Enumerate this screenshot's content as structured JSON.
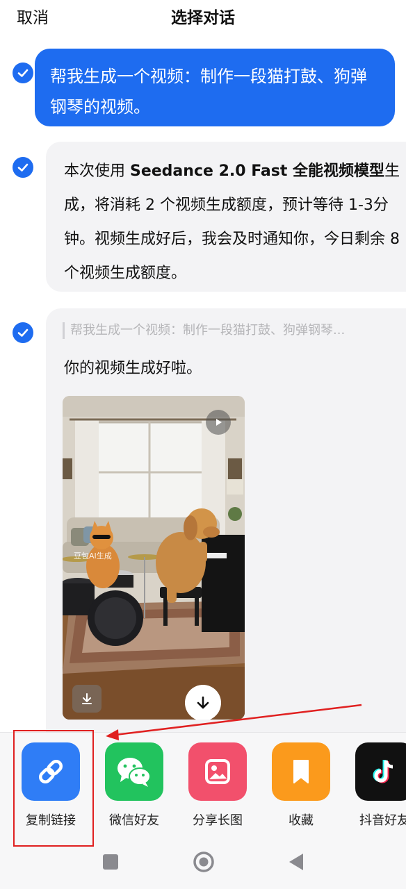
{
  "header": {
    "cancel_label": "取消",
    "title": "选择对话"
  },
  "messages": {
    "user_message": "帮我生成一个视频：制作一段猫打鼓、狗弹钢琴的视频。",
    "bot_message_1": {
      "part1": "本次使用 ",
      "model_name": "Seedance 2.0 Fast 全能视频模型",
      "part2": "生成，将消耗 2 个视频生成额度，预计等待 1-3分钟。视频生成好后，我会及时通知你，今日剩余 8 个视频生成额度。"
    },
    "bot_message_2": {
      "quote": "帮我生成一个视频：制作一段猫打鼓、狗弹钢琴...",
      "reply": "你的视频生成好啦。",
      "video_watermark": "豆包AI生成"
    }
  },
  "share_sheet": {
    "items": [
      {
        "label": "复制链接",
        "icon": "link-icon",
        "color": "#2f7df6"
      },
      {
        "label": "微信好友",
        "icon": "wechat-icon",
        "color": "#22c35e"
      },
      {
        "label": "分享长图",
        "icon": "image-icon",
        "color": "#f2506c"
      },
      {
        "label": "收藏",
        "icon": "bookmark-icon",
        "color": "#fb9a1c"
      },
      {
        "label": "抖音好友",
        "icon": "douyin-icon",
        "color": "#111111"
      }
    ]
  },
  "colors": {
    "accent": "#1e6cf0",
    "annotation_red": "#e02020"
  }
}
